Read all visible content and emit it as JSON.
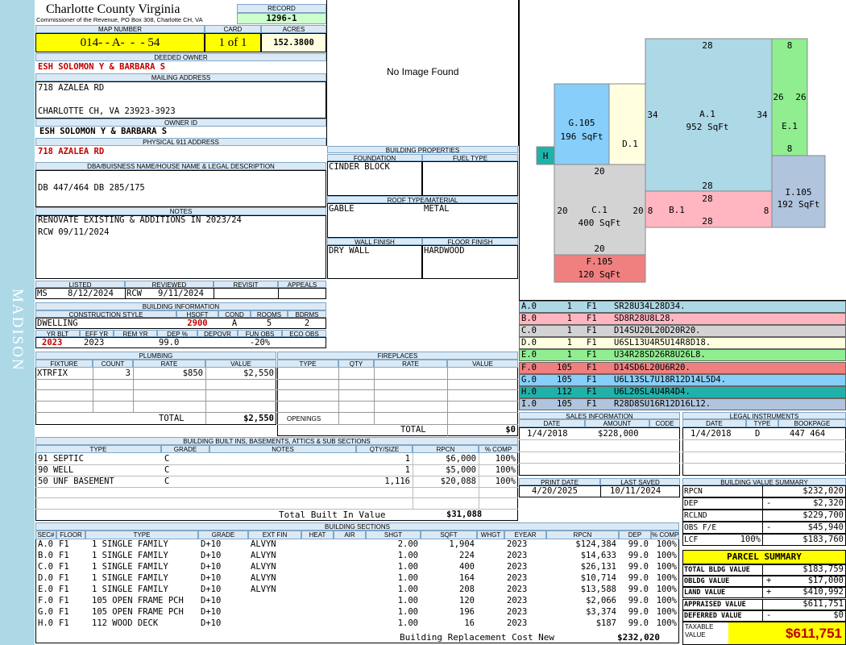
{
  "sidebar_text": "MADISON",
  "county": {
    "title": "Charlotte County Virginia",
    "subtitle": "Commissioner of the Revenue, PO Box 308, Charlotte CH, VA"
  },
  "record": {
    "label": "RECORD",
    "value": "1296-1"
  },
  "map": {
    "label": "MAP NUMBER",
    "value": "014- - A-  -  - 54",
    "card_label": "CARD",
    "card_value": "1 of 1",
    "acres_label": "ACRES",
    "acres_value": "152.3800"
  },
  "deeded_owner": {
    "label": "DEEDED OWNER",
    "value": "ESH SOLOMON Y & BARBARA S"
  },
  "mailing": {
    "label": "MAILING ADDRESS",
    "line1": "718 AZALEA RD",
    "line2": "CHARLOTTE CH, VA 23923-3923"
  },
  "owner_id": {
    "label": "OWNER ID",
    "value": "ESH SOLOMON Y & BARBARA S"
  },
  "physical": {
    "label": "PHYSICAL 911 ADDRESS",
    "value": "718 AZALEA RD"
  },
  "dba": {
    "label": "DBA/BUISNESS NAME/HOUSE NAME & LEGAL DESCRIPTION",
    "value": "DB 447/464 DB 285/175"
  },
  "notes": {
    "label": "NOTES",
    "line1": "RENOVATE EXISTING & ADDITIONS IN 2023/24",
    "line2": "RCW 09/11/2024"
  },
  "photo": {
    "text": "No Image Found"
  },
  "status": {
    "listed_label": "LISTED",
    "listed_by": "MS",
    "listed_date": "8/12/2024",
    "reviewed_label": "REVIEWED",
    "reviewed_by": "RCW",
    "reviewed_date": "9/11/2024",
    "revisit_label": "REVISIT",
    "appeals_label": "APPEALS"
  },
  "bldg_info": {
    "label": "BUILDING INFORMATION",
    "cs_label": "CONSTRUCTION STYLE",
    "hsqft_label": "HSQFT",
    "cond_label": "COND",
    "rooms_label": "ROOMS",
    "bdrms_label": "BDRMS",
    "style": "DWELLING",
    "hsqft": "2900",
    "cond": "A",
    "rooms": "5",
    "bdrms": "2",
    "yrblt_label": "YR BLT",
    "effyr_label": "EFF YR",
    "remyr_label": "REM YR",
    "dep_label": "DEP %",
    "depovr_label": "DEPOVR",
    "funobs_label": "FUN OBS",
    "ecoobs_label": "ECO OBS",
    "yrblt": "2023",
    "effyr": "2023",
    "dep": "99.0",
    "funobs": "-20%"
  },
  "bldg_props": {
    "label": "BUILDING PROPERTIES",
    "foundation_label": "FOUNDATION",
    "fuel_label": "FUEL TYPE",
    "foundation": "CINDER BLOCK",
    "roof_label": "ROOF TYPE/MATERIAL",
    "roof_type": "GABLE",
    "roof_material": "METAL",
    "wall_label": "WALL FINISH",
    "floor_label": "FLOOR FINISH",
    "wall": "DRY WALL",
    "floor": "HARDWOOD"
  },
  "plumbing": {
    "label": "PLUMBING",
    "headers": [
      "FIXTURE",
      "COUNT",
      "RATE",
      "VALUE"
    ],
    "rows": [
      [
        "XTRFIX",
        "3",
        "$850",
        "$2,550"
      ]
    ],
    "total_label": "TOTAL",
    "total": "$2,550"
  },
  "fireplaces": {
    "label": "FIREPLACES",
    "headers": [
      "TYPE",
      "QTY",
      "RATE",
      "VALUE"
    ],
    "openings_label": "OPENINGS",
    "total_label": "TOTAL",
    "total": "$0"
  },
  "builtins": {
    "label": "BUILDING BUILT INS, BASEMENTS, ATTICS & SUB SECTIONS",
    "headers": [
      "TYPE",
      "GRADE",
      "NOTES",
      "QTY/SIZE",
      "RPCN",
      "% COMP"
    ],
    "rows": [
      [
        "91 SEPTIC",
        "C",
        "",
        "1",
        "$6,000",
        "100%"
      ],
      [
        "90 WELL",
        "C",
        "",
        "1",
        "$5,000",
        "100%"
      ],
      [
        "50 UNF BASEMENT",
        "C",
        "",
        "1,116",
        "$20,088",
        "100%"
      ]
    ],
    "total_label": "Total Built In Value",
    "total": "$31,088"
  },
  "sections": {
    "label": "BUILDING SECTIONS",
    "headers": [
      "SEC#",
      "FLOOR",
      "TYPE",
      "GRADE",
      "EXT FIN",
      "HEAT",
      "AIR",
      "SHGT",
      "SQFT",
      "WHGT",
      "EYEAR",
      "RPCN",
      "DEP",
      "% COMP"
    ],
    "rows": [
      [
        "A.0",
        "F1",
        "1 SINGLE FAMILY",
        "D+10",
        "ALVYN",
        "",
        "",
        "2.00",
        "1,904",
        "",
        "2023",
        "$124,384",
        "99.0",
        "100%"
      ],
      [
        "B.0",
        "F1",
        "1 SINGLE FAMILY",
        "D+10",
        "ALVYN",
        "",
        "",
        "1.00",
        "224",
        "",
        "2023",
        "$14,633",
        "99.0",
        "100%"
      ],
      [
        "C.0",
        "F1",
        "1 SINGLE FAMILY",
        "D+10",
        "ALVYN",
        "",
        "",
        "1.00",
        "400",
        "",
        "2023",
        "$26,131",
        "99.0",
        "100%"
      ],
      [
        "D.0",
        "F1",
        "1 SINGLE FAMILY",
        "D+10",
        "ALVYN",
        "",
        "",
        "1.00",
        "164",
        "",
        "2023",
        "$10,714",
        "99.0",
        "100%"
      ],
      [
        "E.0",
        "F1",
        "1 SINGLE FAMILY",
        "D+10",
        "ALVYN",
        "",
        "",
        "1.00",
        "208",
        "",
        "2023",
        "$13,588",
        "99.0",
        "100%"
      ],
      [
        "F.0",
        "F1",
        "105 OPEN FRAME PCH",
        "D+10",
        "",
        "",
        "",
        "1.00",
        "120",
        "",
        "2023",
        "$2,066",
        "99.0",
        "100%"
      ],
      [
        "G.0",
        "F1",
        "105 OPEN FRAME PCH",
        "D+10",
        "",
        "",
        "",
        "1.00",
        "196",
        "",
        "2023",
        "$3,374",
        "99.0",
        "100%"
      ],
      [
        "H.0",
        "F1",
        "112 WOOD DECK",
        "D+10",
        "",
        "",
        "",
        "1.00",
        "16",
        "",
        "2023",
        "$187",
        "99.0",
        "100%"
      ]
    ],
    "total_label": "Building Replacement Cost New",
    "total": "$232,020"
  },
  "sketch": {
    "shapes": [
      {
        "name": "sketch-area-a1",
        "label": "A.1",
        "area": "952 SqFt",
        "color": "#add8e6"
      },
      {
        "name": "sketch-area-b1",
        "label": "B.1",
        "area": "",
        "color": "#ffb6c1"
      },
      {
        "name": "sketch-area-c1",
        "label": "C.1",
        "area": "400 SqFt",
        "color": "#d3d3d3"
      },
      {
        "name": "sketch-area-d1",
        "label": "D.1",
        "area": "",
        "color": "#ffffe0"
      },
      {
        "name": "sketch-area-e1",
        "label": "E.1",
        "area": "",
        "color": "#90ee90"
      },
      {
        "name": "sketch-area-f105",
        "label": "F.105",
        "area": "120 SqFt",
        "color": "#f08080"
      },
      {
        "name": "sketch-area-g105",
        "label": "G.105",
        "area": "196 SqFt",
        "color": "#87cefa"
      },
      {
        "name": "sketch-area-h",
        "label": "H",
        "area": "",
        "color": "#20b2aa"
      },
      {
        "name": "sketch-area-i105",
        "label": "I.105",
        "area": "192 SqFt",
        "color": "#b0c4de"
      }
    ],
    "dims": [
      "28",
      "8",
      "34",
      "34",
      "26",
      "26",
      "8",
      "20",
      "28",
      "28",
      "28",
      "20",
      "20",
      "8",
      "8",
      "20"
    ]
  },
  "legend": [
    {
      "sec": "A.0",
      "code": "1",
      "floor": "F1",
      "desc": "SR28U34L28D34.",
      "color": "#add8e6"
    },
    {
      "sec": "B.0",
      "code": "1",
      "floor": "F1",
      "desc": "SD8R28U8L28.",
      "color": "#ffb6c1"
    },
    {
      "sec": "C.0",
      "code": "1",
      "floor": "F1",
      "desc": "D14SU20L20D20R20.",
      "color": "#d3d3d3"
    },
    {
      "sec": "D.0",
      "code": "1",
      "floor": "F1",
      "desc": "U6SL13U4R5U14R8D18.",
      "color": "#ffffe0"
    },
    {
      "sec": "E.0",
      "code": "1",
      "floor": "F1",
      "desc": "U34R28SD26R8U26L8.",
      "color": "#90ee90"
    },
    {
      "sec": "F.0",
      "code": "105",
      "floor": "F1",
      "desc": "D14SD6L20U6R20.",
      "color": "#f08080"
    },
    {
      "sec": "G.0",
      "code": "105",
      "floor": "F1",
      "desc": "U6L13SL7U18R12D14L5D4.",
      "color": "#87cefa"
    },
    {
      "sec": "H.0",
      "code": "112",
      "floor": "F1",
      "desc": "U6L20SL4U4R4D4.",
      "color": "#20b2aa"
    },
    {
      "sec": "I.0",
      "code": "105",
      "floor": "F1",
      "desc": "R28D8SU16R12D16L12.",
      "color": "#b0c4de"
    }
  ],
  "sales": {
    "label": "SALES INFORMATION",
    "headers": [
      "DATE",
      "AMOUNT",
      "CODE"
    ],
    "rows": [
      [
        "1/4/2018",
        "$228,000",
        ""
      ]
    ]
  },
  "legal": {
    "label": "LEGAL INSTRUMENTS",
    "headers": [
      "DATE",
      "TYPE",
      "BOOKPAGE"
    ],
    "rows": [
      [
        "1/4/2018",
        "D",
        "447 464"
      ]
    ]
  },
  "print": {
    "print_label": "PRINT DATE",
    "print_date": "4/20/2025",
    "saved_label": "LAST SAVED",
    "saved_date": "10/11/2024"
  },
  "value_summary": {
    "label": "BUILDING VALUE SUMMARY",
    "rows": [
      {
        "label": "RPCN",
        "pct": "",
        "sign": "",
        "value": "$232,020"
      },
      {
        "label": "DEP",
        "pct": "",
        "sign": "-",
        "value": "$2,320"
      },
      {
        "label": "RCLND",
        "pct": "",
        "sign": "",
        "value": "$229,700"
      },
      {
        "label": "OBS F/E",
        "pct": "",
        "sign": "-",
        "value": "$45,940"
      },
      {
        "label": "LCF",
        "pct": "100%",
        "sign": "",
        "value": "$183,760"
      }
    ]
  },
  "parcel": {
    "label": "PARCEL SUMMARY",
    "rows": [
      {
        "label": "TOTAL BLDG VALUE",
        "sign": "",
        "value": "$183,759"
      },
      {
        "label": "OBLDG VALUE",
        "sign": "+",
        "value": "$17,000"
      },
      {
        "label": "LAND VALUE",
        "sign": "+",
        "value": "$410,992"
      },
      {
        "label": "APPRAISED VALUE",
        "sign": "",
        "value": "$611,751"
      },
      {
        "label": "DEFERRED VALUE",
        "sign": "-",
        "value": "$0"
      }
    ],
    "taxable_label": "TAXABLE VALUE",
    "taxable_value": "$611,751"
  },
  "colors": {
    "header_bg": "#dbe9f5",
    "yellow": "#ffff00",
    "green": "#ccffcc",
    "sidebar": "#add8e6",
    "red_text": "#c00000"
  }
}
